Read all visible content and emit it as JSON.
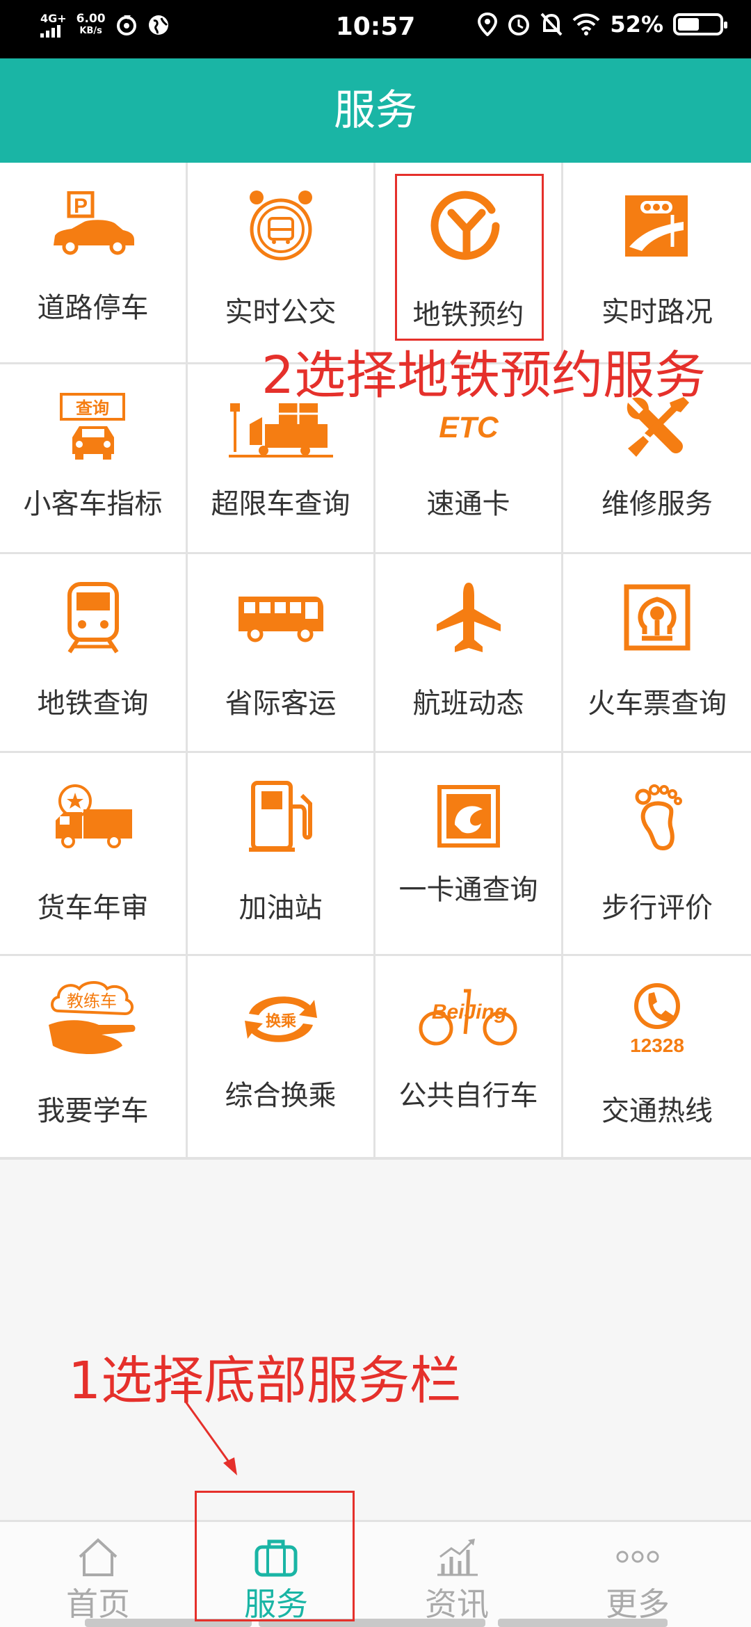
{
  "status_bar": {
    "network": "4G+",
    "speed": "6.00",
    "speed_unit": "KB/s",
    "time": "10:57",
    "battery": "52%",
    "battery_level": 0.52
  },
  "header": {
    "title": "服务"
  },
  "services": [
    [
      {
        "label": "道路停车",
        "icon": "parking-car-icon"
      },
      {
        "label": "实时公交",
        "icon": "alarm-bus-icon"
      },
      {
        "label": "地铁预约",
        "icon": "subway-reservation-icon"
      },
      {
        "label": "实时路况",
        "icon": "traffic-light-icon"
      }
    ],
    [
      {
        "label": "小客车指标",
        "icon": "car-query-icon",
        "badge": "查询"
      },
      {
        "label": "超限车查询",
        "icon": "truck-overload-icon"
      },
      {
        "label": "速通卡",
        "icon": "etc-icon",
        "badge": "ETC"
      },
      {
        "label": "维修服务",
        "icon": "wrench-screwdriver-icon"
      }
    ],
    [
      {
        "label": "地铁查询",
        "icon": "train-icon"
      },
      {
        "label": "省际客运",
        "icon": "coach-bus-icon"
      },
      {
        "label": "航班动态",
        "icon": "airplane-icon"
      },
      {
        "label": "火车票查询",
        "icon": "railway-logo-icon"
      }
    ],
    [
      {
        "label": "货车年审",
        "icon": "truck-inspection-icon"
      },
      {
        "label": "加油站",
        "icon": "fuel-pump-icon"
      },
      {
        "label": "一卡通查询",
        "icon": "card-icon"
      },
      {
        "label": "步行评价",
        "icon": "footprint-icon"
      }
    ],
    [
      {
        "label": "我要学车",
        "icon": "driving-school-icon",
        "badge": "教练车"
      },
      {
        "label": "综合换乘",
        "icon": "transfer-icon",
        "badge": "换乘"
      },
      {
        "label": "公共自行车",
        "icon": "beijing-bike-icon",
        "badge": "BeiJing"
      },
      {
        "label": "交通热线",
        "icon": "hotline-icon",
        "badge": "12328"
      }
    ]
  ],
  "annotations": {
    "step2": "2选择地铁预约服务",
    "step1": "1选择底部服务栏"
  },
  "bottom_nav": [
    {
      "label": "首页",
      "icon": "home-icon"
    },
    {
      "label": "服务",
      "icon": "briefcase-icon",
      "active": true
    },
    {
      "label": "资讯",
      "icon": "chart-icon"
    },
    {
      "label": "更多",
      "icon": "more-dots-icon"
    }
  ],
  "colors": {
    "primary": "#1ab5a5",
    "icon_orange": "#f57d12",
    "annotation_red": "#e5302b",
    "inactive_gray": "#aaaaaa"
  }
}
